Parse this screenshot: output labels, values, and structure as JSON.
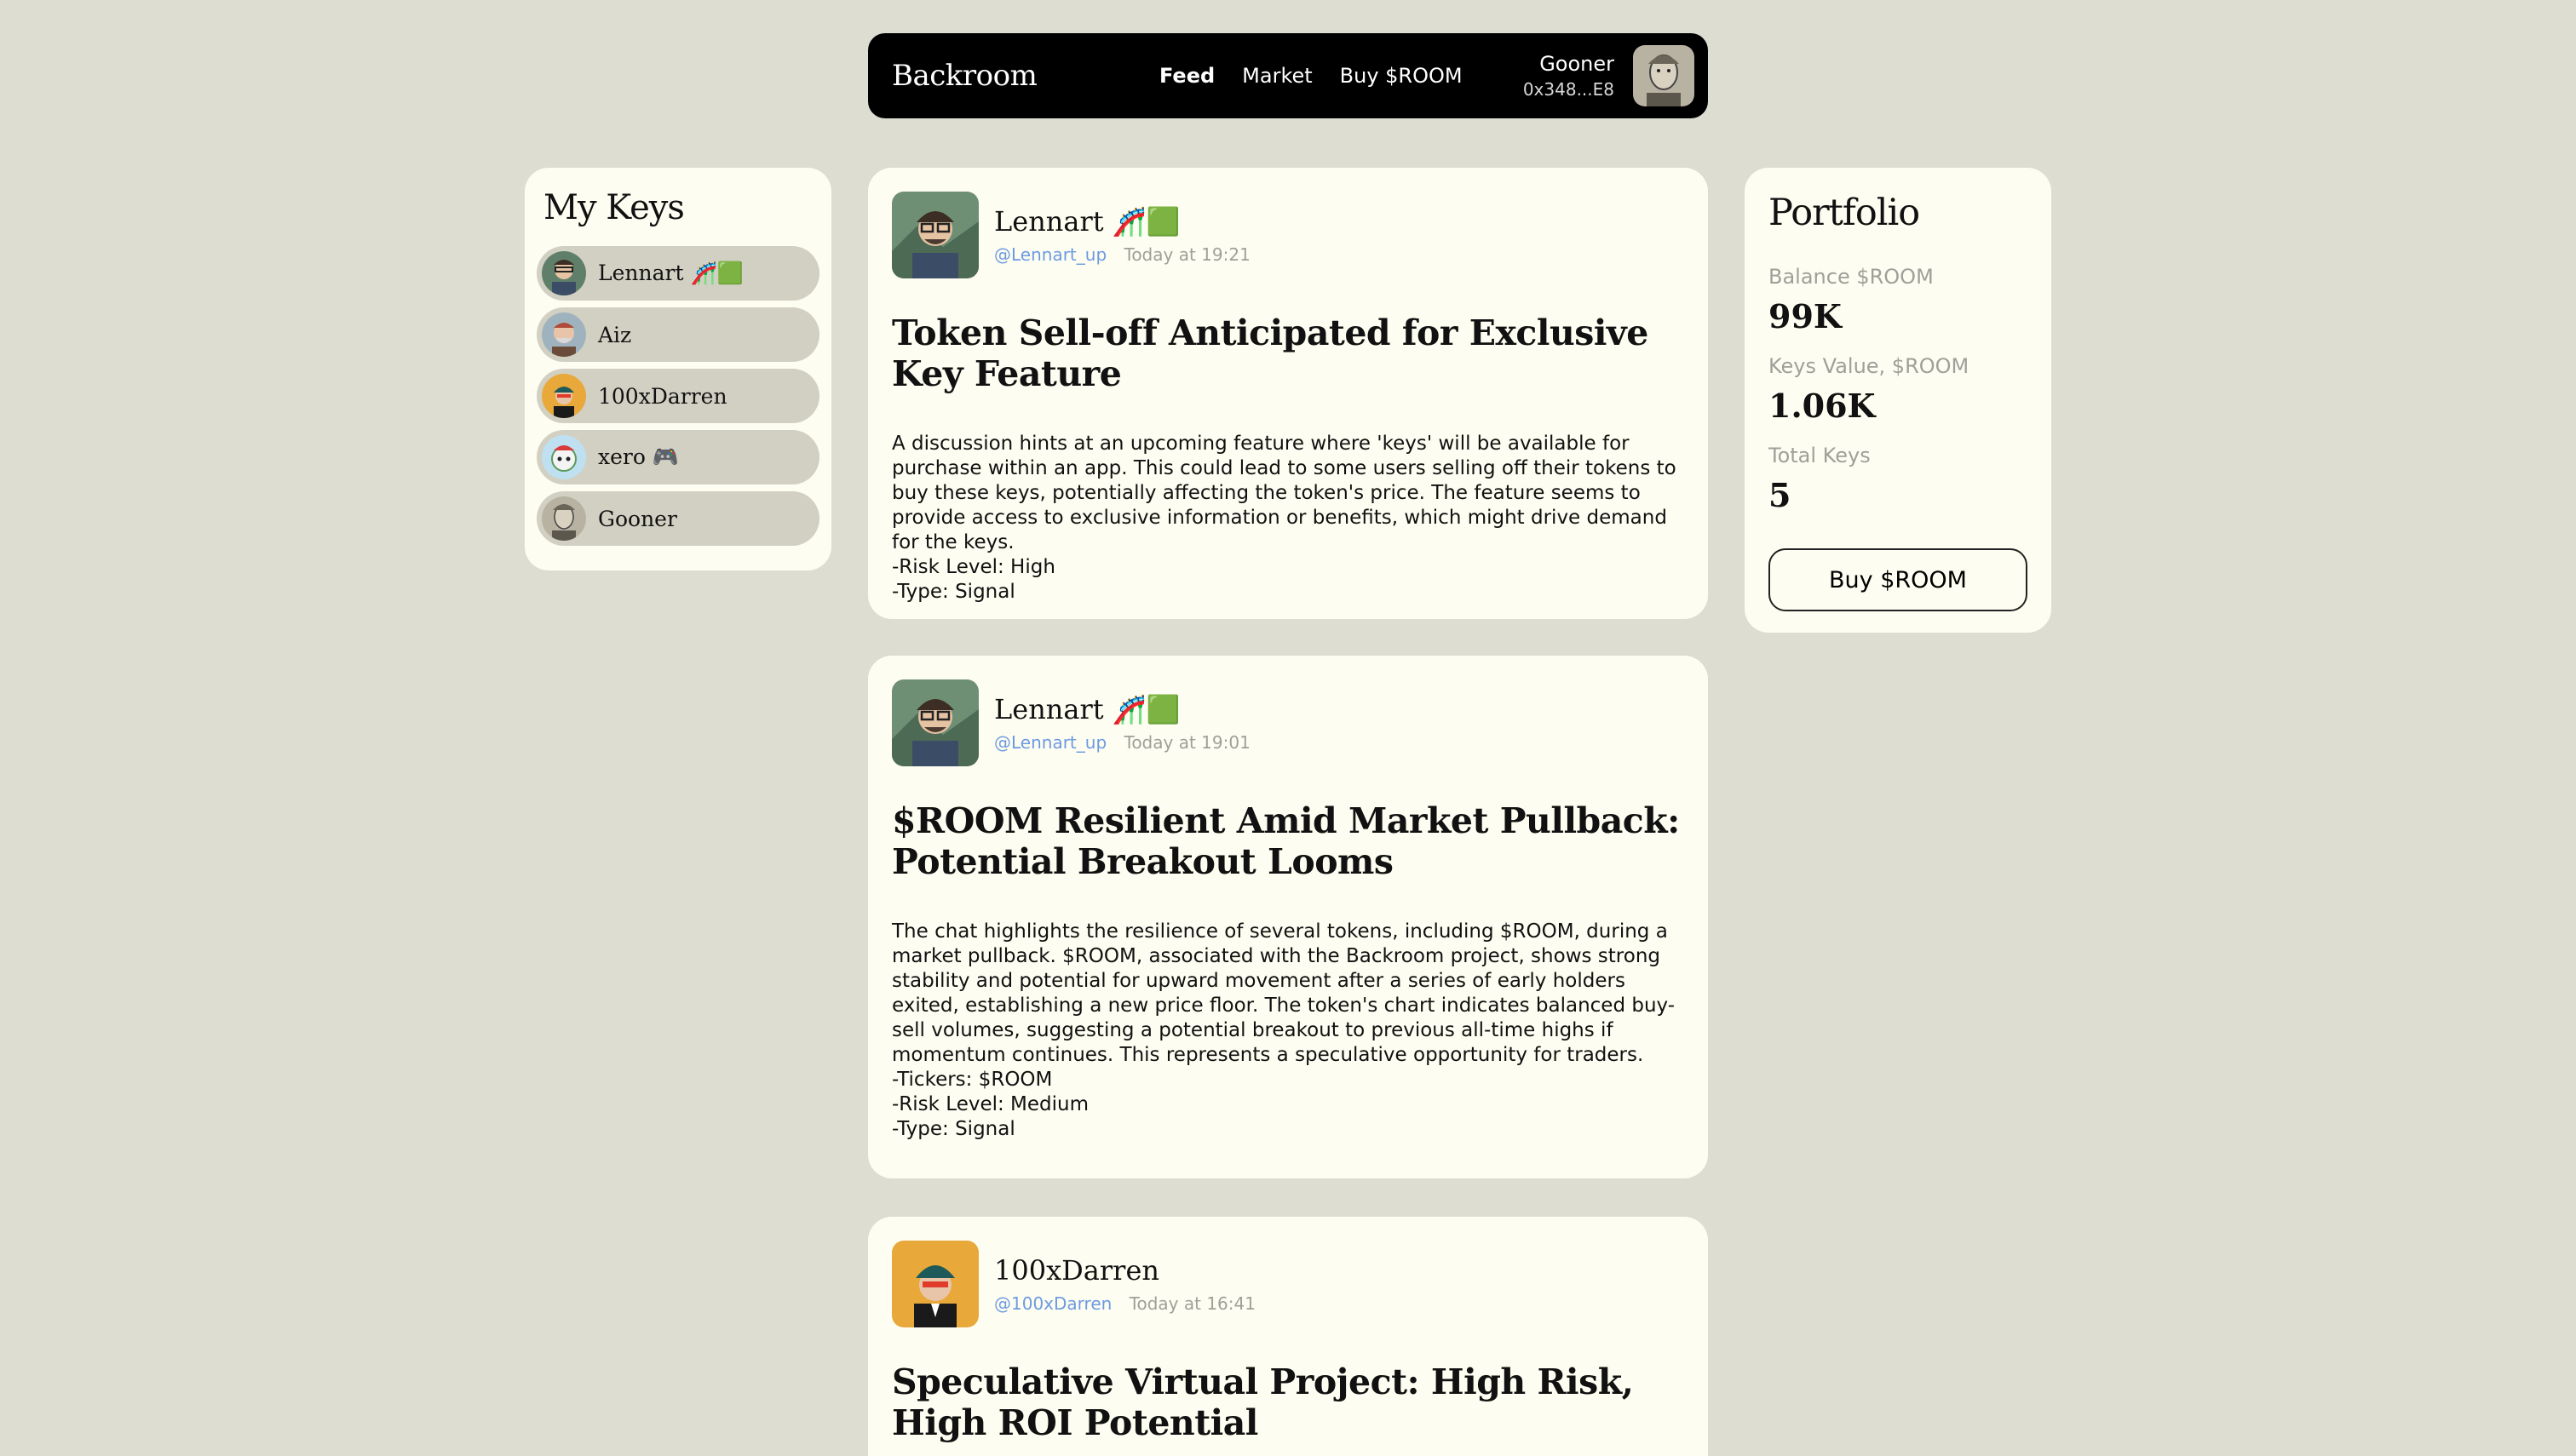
{
  "nav": {
    "brand": "Backroom",
    "links": [
      "Feed",
      "Market",
      "Buy $ROOM"
    ],
    "user_name": "Gooner",
    "user_address": "0x348...E8"
  },
  "sidebar": {
    "title": "My Keys",
    "items": [
      {
        "label": "Lennart 🎢🟩"
      },
      {
        "label": "Aiz"
      },
      {
        "label": "100xDarren"
      },
      {
        "label": "xero 🎮"
      },
      {
        "label": "Gooner"
      }
    ]
  },
  "feed": [
    {
      "author": "Lennart 🎢🟩",
      "handle": "@Lennart_up",
      "time": "Today at 19:21",
      "title": "Token Sell-off Anticipated for Exclusive Key Feature",
      "body": "A discussion hints at an upcoming feature where 'keys' will be available for purchase within an app. This could lead to some users selling off their tokens to buy these keys, potentially affecting the token's price. The feature seems to provide access to exclusive information or benefits, which might drive demand for the keys.\n-Risk Level: High\n-Type: Signal"
    },
    {
      "author": "Lennart 🎢🟩",
      "handle": "@Lennart_up",
      "time": "Today at 19:01",
      "title": "$ROOM Resilient Amid Market Pullback: Potential Breakout Looms",
      "body": "The chat highlights the resilience of several tokens, including $ROOM, during a market pullback. $ROOM, associated with the Backroom project, shows strong stability and potential for upward movement after a series of early holders exited, establishing a new price floor. The token's chart indicates balanced buy-sell volumes, suggesting a potential breakout to previous all-time highs if momentum continues. This represents a speculative opportunity for traders.\n-Tickers: $ROOM\n-Risk Level: Medium\n-Type: Signal"
    },
    {
      "author": "100xDarren",
      "handle": "@100xDarren",
      "time": "Today at 16:41",
      "title": "Speculative Virtual Project: High Risk, High ROI Potential",
      "body": ""
    }
  ],
  "portfolio": {
    "title": "Portfolio",
    "balance_label": "Balance $ROOM",
    "balance_value": "99K",
    "keys_value_label": "Keys Value, $ROOM",
    "keys_value": "1.06K",
    "total_keys_label": "Total Keys",
    "total_keys": "5",
    "buy_label": "Buy $ROOM"
  }
}
